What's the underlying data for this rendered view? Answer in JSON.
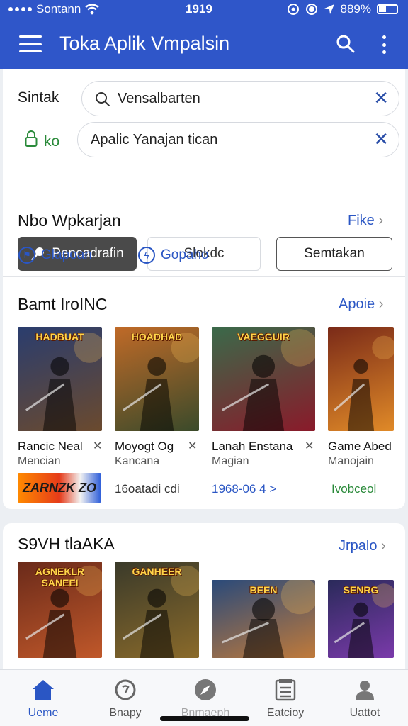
{
  "status_bar": {
    "carrier": "Sontann",
    "time": "1919",
    "battery": "889%"
  },
  "app_bar": {
    "title": "Toka Aplik Vmpalsin"
  },
  "search": {
    "label1": "Sintak",
    "field1_value": "Vensalbarten",
    "label2": "ko",
    "field2_value": "Apalic Yanajan tican"
  },
  "filters": [
    {
      "label": "Pencadrafin"
    },
    {
      "label": "Slokdc"
    },
    {
      "label": "Semtakan"
    }
  ],
  "recommend": {
    "title": "Nbo Wpkarjan",
    "link": "Fike",
    "sub_links": [
      "Glapoan",
      "Gopaho"
    ]
  },
  "section1": {
    "title": "Bamt IroINC",
    "link": "Apoie",
    "games": [
      {
        "name": "Rancic Neal",
        "sub": "Mencian",
        "meta": "",
        "art": "HADBUAT",
        "colors": [
          "#2a3d6e",
          "#6b4a2e"
        ]
      },
      {
        "name": "Moyogt Og",
        "sub": "Kancana",
        "meta": "16oatadi cdi",
        "art": "HOADHAD",
        "colors": [
          "#c06a28",
          "#3a4a2a"
        ]
      },
      {
        "name": "Lanah Enstana",
        "sub": "Magian",
        "meta": "1968-06 4 >",
        "art": "VAEGGUIR",
        "colors": [
          "#3a6a4a",
          "#8a1a2a"
        ]
      },
      {
        "name": "Game Abed",
        "sub": "Manojain",
        "meta": "Ivobceol",
        "art": "",
        "colors": [
          "#7a2a18",
          "#e08a28"
        ]
      }
    ],
    "badge_text": "ZARNZK ZO"
  },
  "section2": {
    "title": "S9VH tlaAKA",
    "link": "Jrpalo",
    "games": [
      {
        "art": "AGNEKLR SANEEI",
        "colors": [
          "#6a2a1a",
          "#c0582a"
        ]
      },
      {
        "art": "GANHEER",
        "colors": [
          "#3a3a2a",
          "#8a6a2a"
        ]
      },
      {
        "art": "BEEN",
        "colors": [
          "#2a4a7a",
          "#c07a3a"
        ]
      },
      {
        "art": "SENRG",
        "colors": [
          "#2a2a5a",
          "#7a3aaa"
        ]
      }
    ]
  },
  "bottom_nav": [
    {
      "label": "Ueme",
      "icon": "home-icon",
      "active": true
    },
    {
      "label": "Bnapy",
      "icon": "clock-icon",
      "active": false
    },
    {
      "label": "Bnmaeph",
      "icon": "compass-icon",
      "active": false
    },
    {
      "label": "Eatcioy",
      "icon": "list-icon",
      "active": false
    },
    {
      "label": "Uattot",
      "icon": "person-icon",
      "active": false
    }
  ],
  "colors": {
    "primary": "#2f56c9",
    "link": "#2a56c4",
    "green": "#2a8a3a"
  }
}
